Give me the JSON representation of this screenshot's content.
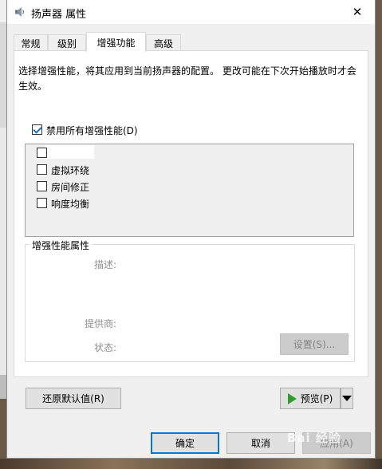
{
  "window": {
    "title": "扬声器 属性",
    "close_glyph": "✕"
  },
  "tabs": [
    {
      "label": "常规",
      "active": false
    },
    {
      "label": "级别",
      "active": false
    },
    {
      "label": "增强功能",
      "active": true
    },
    {
      "label": "高级",
      "active": false
    }
  ],
  "enhancements": {
    "description": "选择增强性能，将其应用到当前扬声器的配置。 更改可能在下次开始播放时才会生效。",
    "disable_all": {
      "label": "禁用所有增强性能(D)",
      "checked": true
    },
    "items": [
      {
        "label": "",
        "checked": false
      },
      {
        "label": "虚拟环绕",
        "checked": false
      },
      {
        "label": "房间修正",
        "checked": false
      },
      {
        "label": "响度均衡",
        "checked": false
      }
    ]
  },
  "properties": {
    "group_title": "增强性能属性",
    "description_label": "描述:",
    "provider_label": "提供商:",
    "status_label": "状态:",
    "settings_button": "设置(S)..."
  },
  "actions": {
    "restore_defaults": "还原默认值(R)",
    "preview": "预览(P)"
  },
  "footer": {
    "ok": "确定",
    "cancel": "取消",
    "apply": "应用(A)"
  },
  "watermark": "Bai 经验"
}
